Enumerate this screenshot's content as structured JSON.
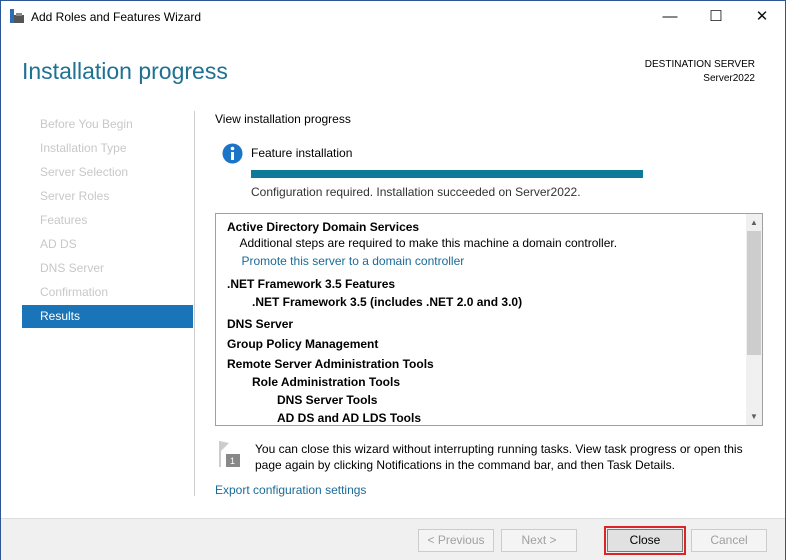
{
  "window": {
    "title": "Add Roles and Features Wizard",
    "minimize": "—",
    "maximize": "☐",
    "close": "✕"
  },
  "header": {
    "title": "Installation progress",
    "dest_label": "DESTINATION SERVER",
    "dest_server": "Server2022"
  },
  "nav": {
    "items": [
      "Before You Begin",
      "Installation Type",
      "Server Selection",
      "Server Roles",
      "Features",
      "AD DS",
      "DNS Server",
      "Confirmation",
      "Results"
    ],
    "selected": "Results"
  },
  "main": {
    "heading": "View installation progress",
    "feature_label": "Feature installation",
    "progress_percent": 100,
    "progress_color": "#0e7a9a",
    "status": "Configuration required. Installation succeeded on Server2022.",
    "results": [
      {
        "text": "Active Directory Domain Services",
        "level": 0,
        "bold": true
      },
      {
        "text": "Additional steps are required to make this machine a domain controller.",
        "level": 1,
        "bold": false
      },
      {
        "text": "Promote this server to a domain controller",
        "level": 1,
        "link": true
      },
      {
        "text": ".NET Framework 3.5 Features",
        "level": 0,
        "bold": true
      },
      {
        "text": ".NET Framework 3.5 (includes .NET 2.0 and 3.0)",
        "level": 2,
        "bold": true
      },
      {
        "text": "DNS Server",
        "level": 0,
        "bold": true
      },
      {
        "text": "Group Policy Management",
        "level": 0,
        "bold": true
      },
      {
        "text": "Remote Server Administration Tools",
        "level": 0,
        "bold": true
      },
      {
        "text": "Role Administration Tools",
        "level": 2,
        "bold": true
      },
      {
        "text": "DNS Server Tools",
        "level": 4,
        "bold": true
      },
      {
        "text": "AD DS and AD LDS Tools",
        "level": 4,
        "bold": true
      }
    ],
    "note": "You can close this wizard without interrupting running tasks. View task progress or open this page again by clicking Notifications in the command bar, and then Task Details.",
    "notification_count": "1",
    "export_link": "Export configuration settings"
  },
  "footer": {
    "previous": "< Previous",
    "next": "Next >",
    "close": "Close",
    "cancel": "Cancel"
  }
}
